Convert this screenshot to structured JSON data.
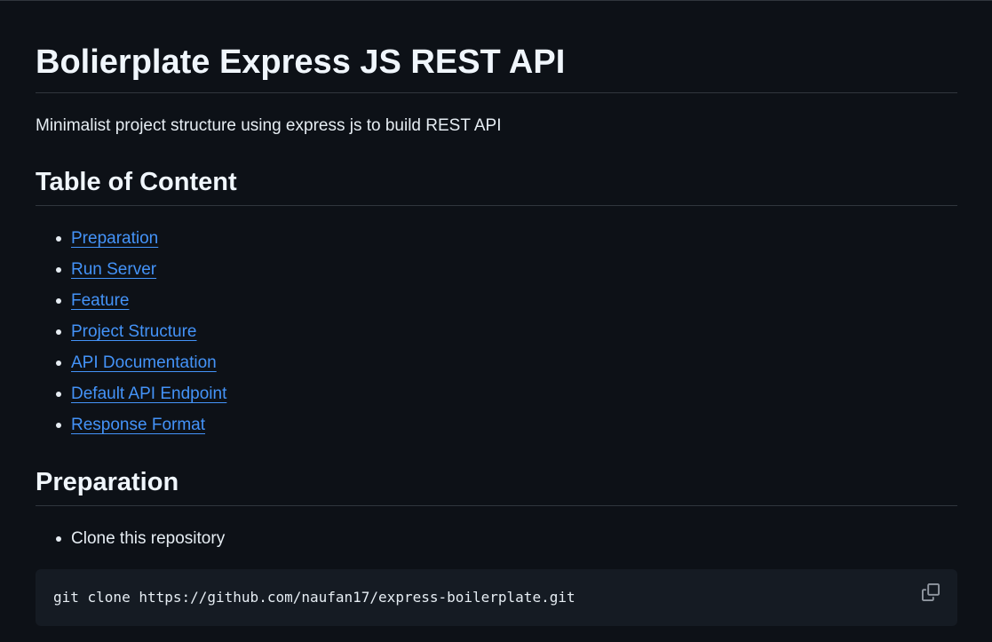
{
  "readme": {
    "title": "Bolierplate Express JS REST API",
    "description": "Minimalist project structure using express js to build REST API",
    "toc": {
      "heading": "Table of Content",
      "items": [
        {
          "label": "Preparation"
        },
        {
          "label": "Run Server"
        },
        {
          "label": "Feature"
        },
        {
          "label": "Project Structure"
        },
        {
          "label": "API Documentation"
        },
        {
          "label": "Default API Endpoint"
        },
        {
          "label": "Response Format"
        }
      ]
    },
    "preparation": {
      "heading": "Preparation",
      "items": [
        {
          "label": "Clone this repository"
        }
      ],
      "code": "git clone https://github.com/naufan17/express-boilerplate.git",
      "copy_icon": "copy-icon"
    }
  },
  "colors": {
    "background": "#0d1117",
    "text": "#e6edf3",
    "link": "#4493f8",
    "divider": "#30363d",
    "code_background": "#151b23"
  }
}
